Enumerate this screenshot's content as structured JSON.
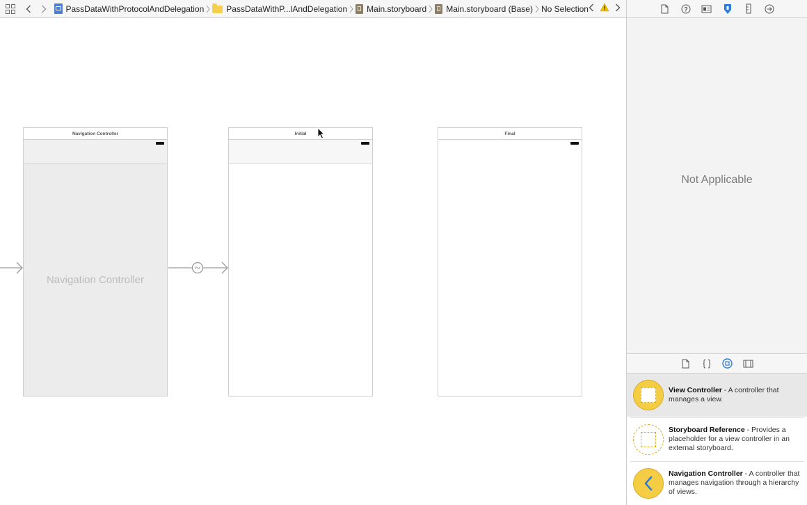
{
  "breadcrumbs": [
    {
      "label": "PassDataWithProtocolAndDelegation",
      "icon": "project-icon"
    },
    {
      "label": "PassDataWithP...lAndDelegation",
      "icon": "folder-icon"
    },
    {
      "label": "Main.storyboard",
      "icon": "storyboard-icon"
    },
    {
      "label": "Main.storyboard (Base)",
      "icon": "storyboard-icon"
    },
    {
      "label": "No Selection",
      "icon": ""
    }
  ],
  "scenes": {
    "navigation": {
      "title": "Navigation Controller",
      "body_label": "Navigation Controller"
    },
    "initial": {
      "title": "Initial"
    },
    "final": {
      "title": "Final"
    }
  },
  "inspector": {
    "status_text": "Not Applicable",
    "tabs": [
      "file-inspector-icon",
      "quick-help-icon",
      "identity-inspector-icon",
      "attributes-inspector-icon",
      "size-inspector-icon",
      "connections-inspector-icon"
    ]
  },
  "library": {
    "tabs": [
      "file-template-icon",
      "code-snippet-icon",
      "object-library-icon",
      "media-library-icon"
    ],
    "items": [
      {
        "title": "View Controller",
        "desc": " - A controller that manages a view."
      },
      {
        "title": "Storyboard Reference",
        "desc": " - Provides a placeholder for a view controller in an external storyboard."
      },
      {
        "title": "Navigation Controller",
        "desc": " - A controller that manages navigation through a hierarchy of views."
      }
    ]
  },
  "colors": {
    "accent": "#2e7cd6",
    "library_icon": "#f4cd45",
    "warning": "#f2c200"
  }
}
